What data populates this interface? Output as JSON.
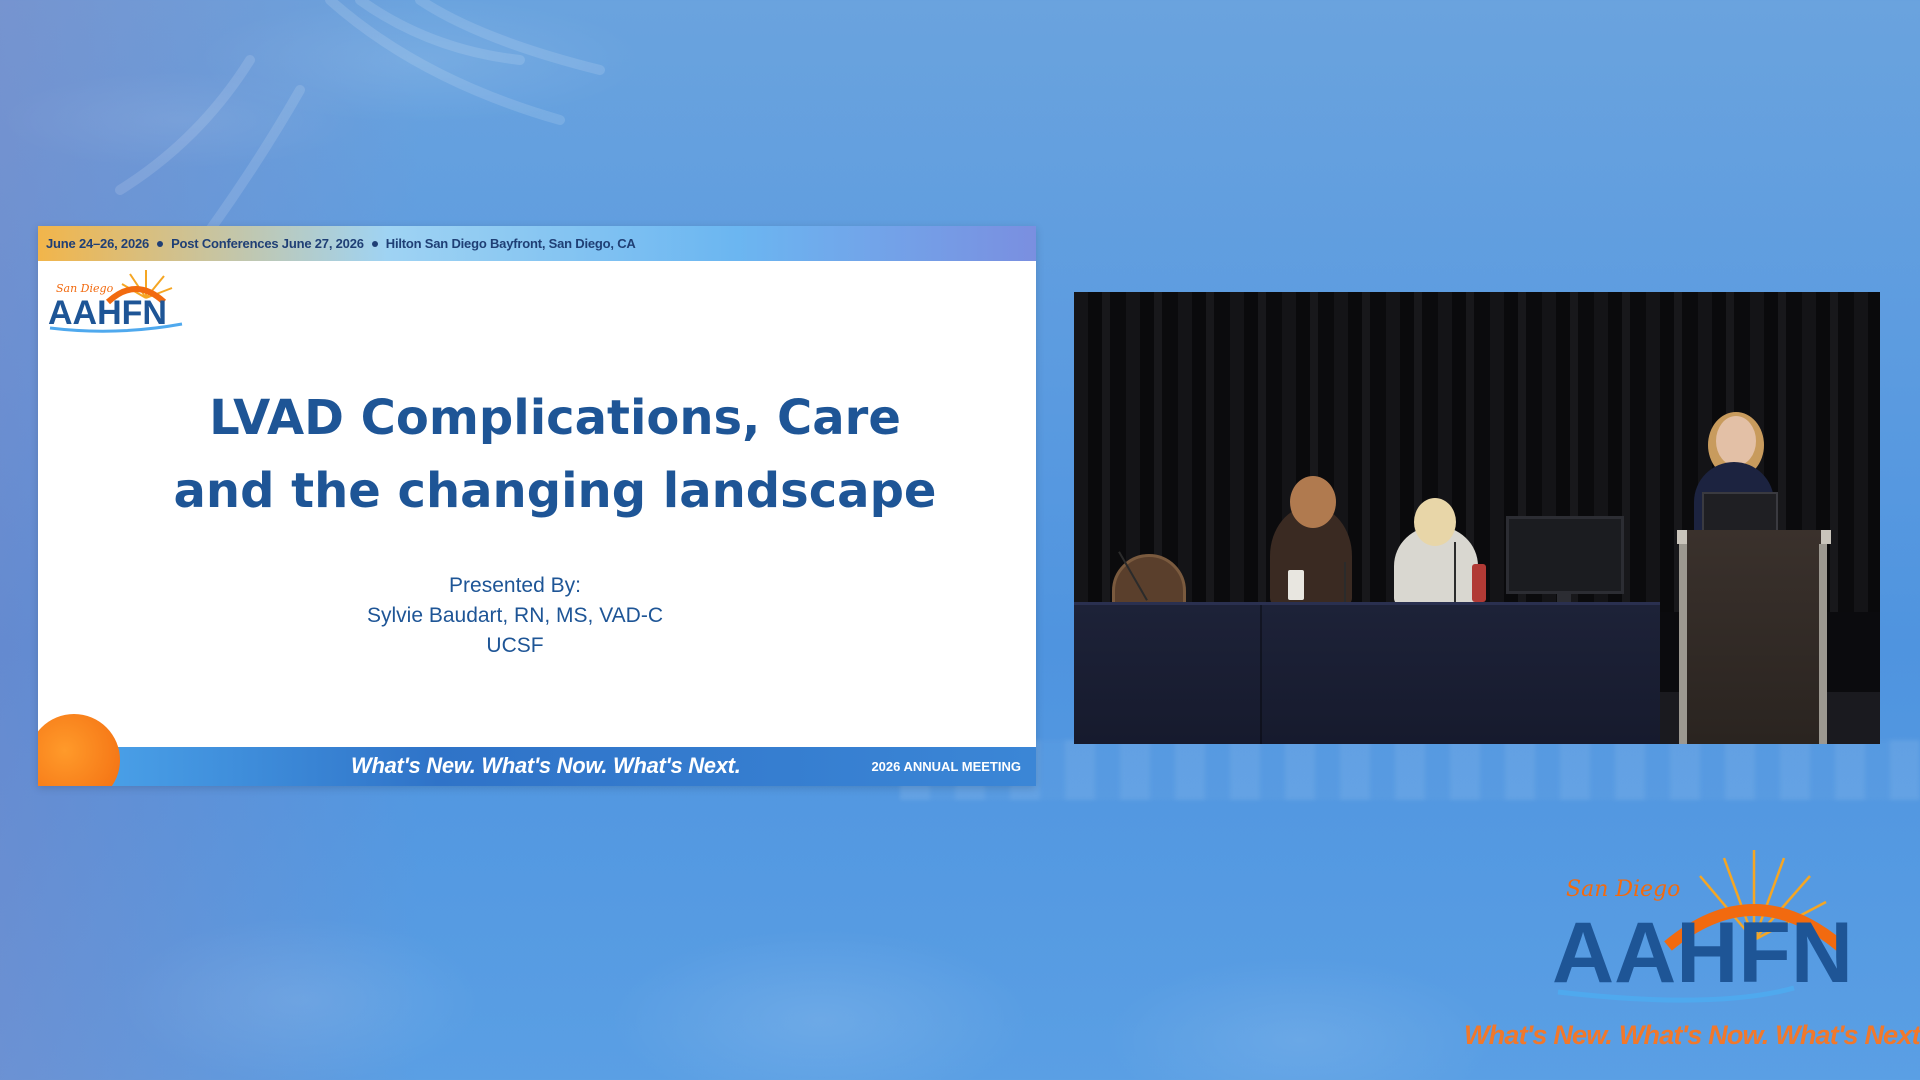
{
  "slide": {
    "topbar": {
      "dates": "June 24–26, 2026",
      "post_conferences": "Post Conferences June 27, 2026",
      "venue": "Hilton San Diego Bayfront, San Diego, CA"
    },
    "logo": {
      "script": "San Diego",
      "wordmark": "AAHFN"
    },
    "title_line1": "LVAD Complications, Care",
    "title_line2": "and the changing landscape",
    "presented_by": "Presented By:",
    "presenter": "Sylvie Baudart, RN, MS, VAD-C",
    "affiliation": "UCSF",
    "tagline": "What's New. What's Now. What's Next.",
    "meeting": "2026 ANNUAL MEETING"
  },
  "corner_logo": {
    "script": "San Diego",
    "wordmark": "AAHFN",
    "tagline": "What's New. What's Now. What's Next."
  },
  "colors": {
    "brand_blue": "#1e5596",
    "accent_orange": "#f1782b",
    "background_blue": "#5b9be0"
  }
}
